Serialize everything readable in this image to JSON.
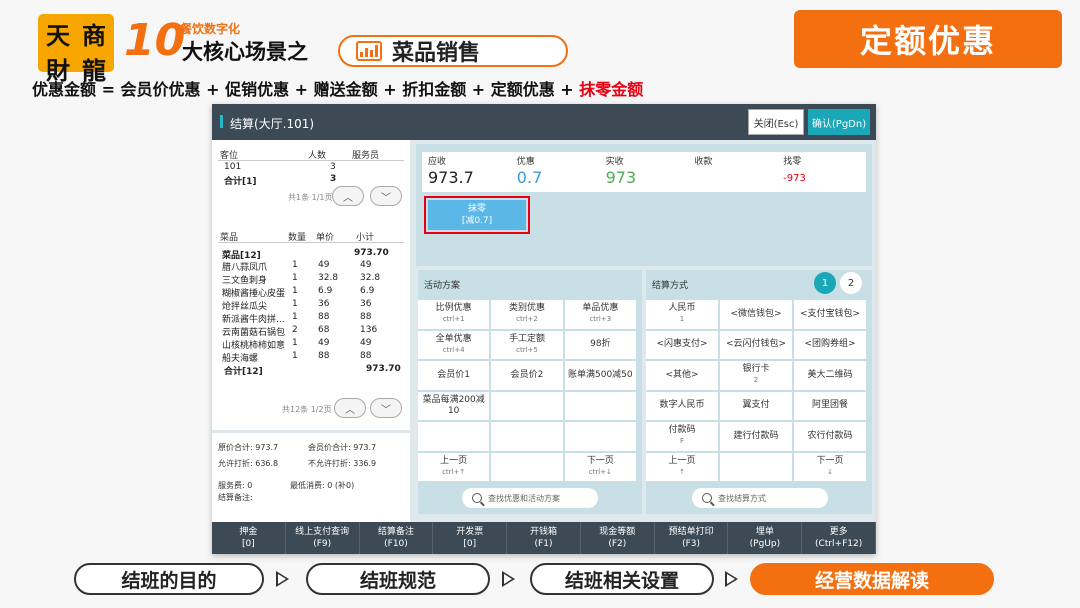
{
  "brand": {
    "logo_chars": [
      "天",
      "商",
      "財",
      "龍"
    ],
    "number": "10",
    "subtitle": "餐饮数字化",
    "title_prefix": "大核心场景之",
    "title_main": "菜品销售"
  },
  "badge": "定额优惠",
  "formula": {
    "text": "优惠金额 = 会员价优惠 + 促销优惠 + 赠送金额 + 折扣金额 + 定额优惠 + ",
    "highlight": "抹零金额"
  },
  "window": {
    "title": "结算(大厅.101)",
    "close_label": "关闭(Esc)",
    "confirm_label": "确认(PgDn)",
    "seats": {
      "headers": [
        "客位",
        "人数",
        "服务员"
      ],
      "rows": [
        [
          "101",
          "3",
          ""
        ]
      ],
      "total": [
        "合计[1]",
        "3"
      ],
      "page": "共1条 1/1页"
    },
    "dishes": {
      "headers": [
        "菜品",
        "数量",
        "单价",
        "小计"
      ],
      "group": [
        "菜品[12]",
        "973.70"
      ],
      "rows": [
        [
          "腊八蒜凤爪",
          "1",
          "49",
          "49"
        ],
        [
          "三文鱼刺身",
          "1",
          "32.8",
          "32.8"
        ],
        [
          "糊椒酱捶心皮蛋",
          "1",
          "6.9",
          "6.9"
        ],
        [
          "炝拌丝瓜尖",
          "1",
          "36",
          "36"
        ],
        [
          "新派酱牛肉拼...",
          "1",
          "88",
          "88"
        ],
        [
          "云南菌菇石锅包",
          "2",
          "68",
          "136"
        ],
        [
          "山核桃柿柿如意",
          "1",
          "49",
          "49"
        ],
        [
          "船夫海螺",
          "1",
          "88",
          "88"
        ]
      ],
      "total": [
        "合计[12]",
        "973.70"
      ],
      "page": "共12条 1/2页"
    },
    "footer": {
      "orig_total": "原价合计: 973.7",
      "member_total": "会员价合计: 973.7",
      "allow_discount": "允许打折: 636.8",
      "no_discount": "不允许打折: 336.9",
      "service_fee": "服务费: 0",
      "min_spend": "最低消费: 0 (补0)",
      "remark": "结算备注:"
    },
    "summary": [
      {
        "label": "应收",
        "value": "973.7",
        "color": "#222"
      },
      {
        "label": "优惠",
        "value": "0.7",
        "color": "#3a9ad9"
      },
      {
        "label": "实收",
        "value": "973",
        "color": "#4caf50"
      },
      {
        "label": "收款",
        "value": "",
        "color": "#222"
      },
      {
        "label": "找零",
        "value": "-973",
        "color": "#e60012"
      }
    ],
    "moling": {
      "label": "抹零",
      "detail": "[减0.7]"
    },
    "promo": {
      "title": "活动方案",
      "cells": [
        [
          "比例优惠",
          "ctrl+1"
        ],
        [
          "类别优惠",
          "ctrl+2"
        ],
        [
          "单品优惠",
          "ctrl+3"
        ],
        [
          "全单优惠",
          "ctrl+4"
        ],
        [
          "手工定额",
          "ctrl+5"
        ],
        [
          "98折",
          ""
        ],
        [
          "会员价1",
          ""
        ],
        [
          "会员价2",
          ""
        ],
        [
          "账单满500减50",
          ""
        ],
        [
          "菜品每满200减10",
          ""
        ],
        [
          "",
          ""
        ],
        [
          "",
          ""
        ],
        [
          "",
          ""
        ],
        [
          "",
          ""
        ],
        [
          "",
          ""
        ],
        [
          "上一页",
          "ctrl+↑"
        ],
        [
          "",
          ""
        ],
        [
          "下一页",
          "ctrl+↓"
        ]
      ],
      "search": "查找优惠和活动方案"
    },
    "pay": {
      "title": "结算方式",
      "pages": [
        "1",
        "2"
      ],
      "cells": [
        [
          "人民币",
          "1"
        ],
        [
          "<微信钱包>",
          ""
        ],
        [
          "<支付宝钱包>",
          ""
        ],
        [
          "<闪惠支付>",
          ""
        ],
        [
          "<云闪付钱包>",
          ""
        ],
        [
          "<团购券组>",
          ""
        ],
        [
          "<其他>",
          ""
        ],
        [
          "银行卡",
          "2"
        ],
        [
          "美大二维码",
          ""
        ],
        [
          "数字人民币",
          ""
        ],
        [
          "翼支付",
          ""
        ],
        [
          "阿里团餐",
          ""
        ],
        [
          "付款码",
          "F"
        ],
        [
          "建行付款码",
          ""
        ],
        [
          "农行付款码",
          ""
        ],
        [
          "上一页",
          "↑"
        ],
        [
          "",
          ""
        ],
        [
          "下一页",
          "↓"
        ]
      ],
      "search": "查找结算方式"
    },
    "toolbar": [
      [
        "押金",
        "[0]"
      ],
      [
        "线上支付查询",
        "(F9)"
      ],
      [
        "结算备注",
        "(F10)"
      ],
      [
        "开发票",
        "[0]"
      ],
      [
        "开钱箱",
        "(F1)"
      ],
      [
        "现金等额",
        "(F2)"
      ],
      [
        "预结单打印",
        "(F3)"
      ],
      [
        "埋单",
        "(PgUp)"
      ],
      [
        "更多",
        "(Ctrl+F12)"
      ]
    ]
  },
  "nav": [
    "结班的目的",
    "结班规范",
    "结班相关设置",
    "经营数据解读"
  ]
}
